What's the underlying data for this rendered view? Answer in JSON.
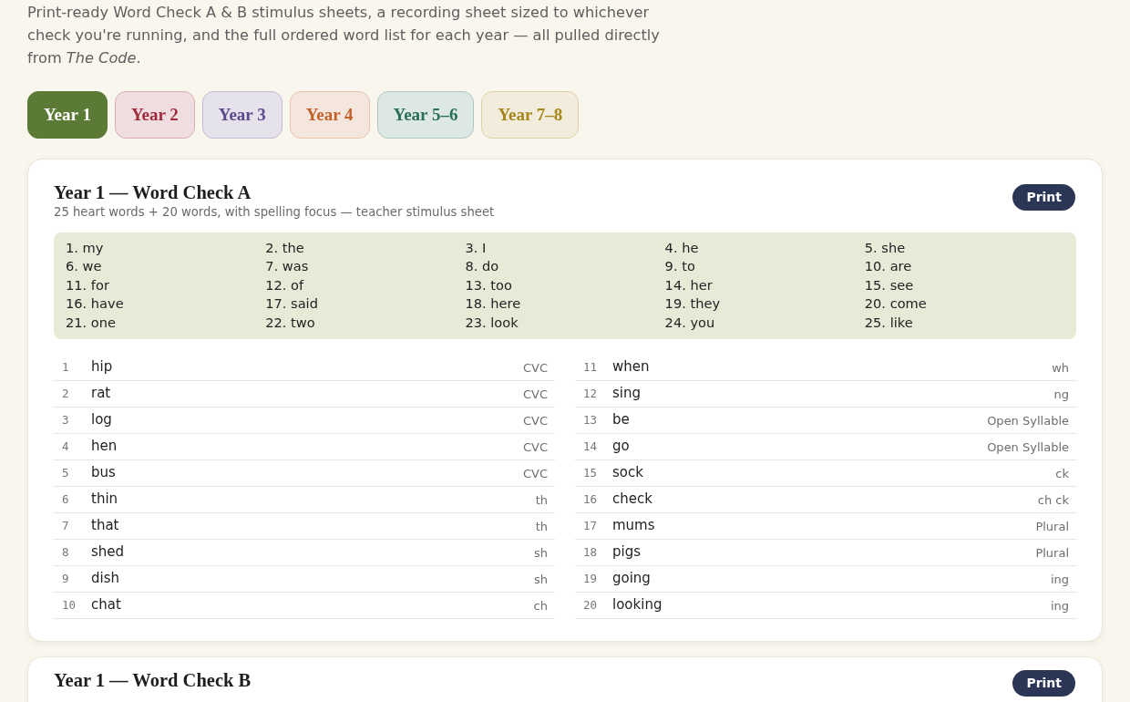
{
  "intro": "Print-ready Word Check A & B stimulus sheets, a recording sheet sized to whichever check you're running, and the full ordered word list for each year — all pulled directly from *The Code*.",
  "tabs": [
    {
      "label": "Year 1",
      "selected": true,
      "color": "#5a7a36"
    },
    {
      "label": "Year 2",
      "selected": false,
      "color": "#9e2a3c"
    },
    {
      "label": "Year 3",
      "selected": false,
      "color": "#5b4a8b"
    },
    {
      "label": "Year 4",
      "selected": false,
      "color": "#c2622a"
    },
    {
      "label": "Year 5–6",
      "selected": false,
      "color": "#2a6e5b"
    },
    {
      "label": "Year 7–8",
      "selected": false,
      "color": "#a8861c"
    }
  ],
  "cards": [
    {
      "title": "Year 1 — Word Check A",
      "subtitle": "25 heart words + 20 words, with spelling focus — teacher stimulus sheet",
      "print_button": "Print",
      "heart_words": [
        "1. my",
        "2. the",
        "3. I",
        "4. he",
        "5. she",
        "6. we",
        "7. was",
        "8. do",
        "9. to",
        "10. are",
        "11. for",
        "12. of",
        "13. too",
        "14. her",
        "15. see",
        "16. have",
        "17. said",
        "18. here",
        "19. they",
        "20. come",
        "21. one",
        "22. two",
        "23. look",
        "24. you",
        "25. like"
      ],
      "word_columns": [
        [
          {
            "number": "1",
            "word": "hip",
            "focus": "CVC"
          },
          {
            "number": "2",
            "word": "rat",
            "focus": "CVC"
          },
          {
            "number": "3",
            "word": "log",
            "focus": "CVC"
          },
          {
            "number": "4",
            "word": "hen",
            "focus": "CVC"
          },
          {
            "number": "5",
            "word": "bus",
            "focus": "CVC"
          },
          {
            "number": "6",
            "word": "thin",
            "focus": "th"
          },
          {
            "number": "7",
            "word": "that",
            "focus": "th"
          },
          {
            "number": "8",
            "word": "shed",
            "focus": "sh"
          },
          {
            "number": "9",
            "word": "dish",
            "focus": "sh"
          },
          {
            "number": "10",
            "word": "chat",
            "focus": "ch"
          }
        ],
        [
          {
            "number": "11",
            "word": "when",
            "focus": "wh"
          },
          {
            "number": "12",
            "word": "sing",
            "focus": "ng"
          },
          {
            "number": "13",
            "word": "be",
            "focus": "Open Syllable"
          },
          {
            "number": "14",
            "word": "go",
            "focus": "Open Syllable"
          },
          {
            "number": "15",
            "word": "sock",
            "focus": "ck"
          },
          {
            "number": "16",
            "word": "check",
            "focus": "ch ck"
          },
          {
            "number": "17",
            "word": "mums",
            "focus": "Plural"
          },
          {
            "number": "18",
            "word": "pigs",
            "focus": "Plural"
          },
          {
            "number": "19",
            "word": "going",
            "focus": "ing"
          },
          {
            "number": "20",
            "word": "looking",
            "focus": "ing"
          }
        ]
      ]
    },
    {
      "title": "Year 1 — Word Check B",
      "print_button": "Print"
    }
  ]
}
